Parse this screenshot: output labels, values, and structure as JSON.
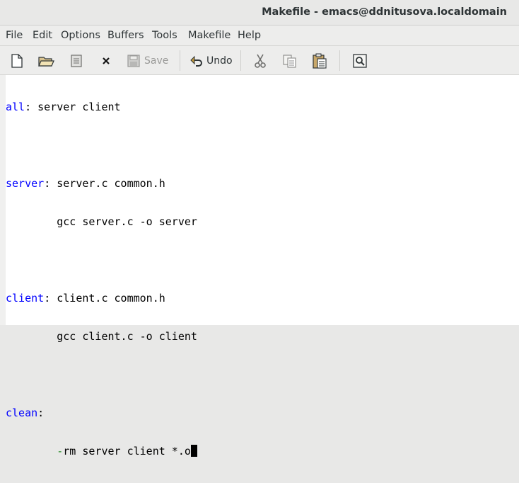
{
  "window": {
    "title": "Makefile - emacs@ddnitusova.localdomain"
  },
  "menubar": {
    "items": [
      "File",
      "Edit",
      "Options",
      "Buffers",
      "Tools",
      "Makefile",
      "Help"
    ]
  },
  "toolbar": {
    "save_label": "Save",
    "undo_label": "Undo",
    "icons": [
      "new-file-icon",
      "open-folder-icon",
      "dired-icon",
      "close-icon",
      "save-icon",
      "undo-icon",
      "cut-icon",
      "copy-icon",
      "paste-icon",
      "search-icon"
    ]
  },
  "editor": {
    "lines": [
      {
        "target": "all",
        "colon": ":",
        "rest": " server client"
      },
      {
        "text": ""
      },
      {
        "target": "server",
        "colon": ":",
        "rest": " server.c common.h"
      },
      {
        "indent": "        ",
        "text": "gcc server.c -o server"
      },
      {
        "text": ""
      },
      {
        "target": "client",
        "colon": ":",
        "rest": " client.c common.h"
      },
      {
        "indent": "        ",
        "text": "gcc client.c -o client"
      },
      {
        "text": ""
      },
      {
        "target": "clean",
        "colon": ":",
        "rest": ""
      },
      {
        "indent": "        ",
        "prefix": "-",
        "text": "rm server client *.o"
      }
    ]
  },
  "colors": {
    "target": "#0000ff",
    "prefix": "#228b22",
    "cursor": "#000000"
  }
}
